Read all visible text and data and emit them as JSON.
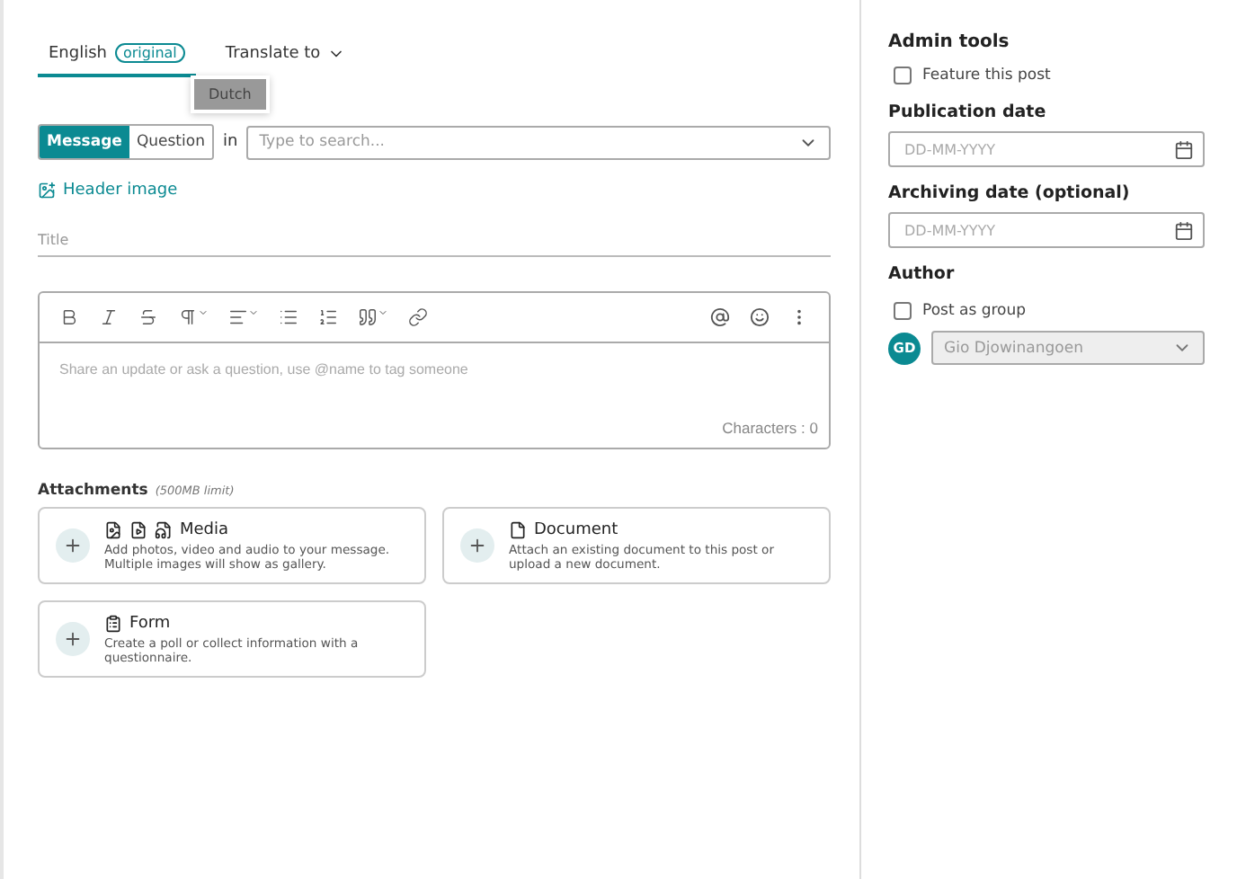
{
  "tabs": [
    {
      "label": "English",
      "badge": "original",
      "selected": true
    },
    {
      "label": "Translate to",
      "selected": false
    }
  ],
  "translate_menu": {
    "items": [
      {
        "label": "Dutch",
        "highlighted": true
      }
    ]
  },
  "post_type": [
    {
      "label": "Message",
      "selected": true
    },
    {
      "label": "Question",
      "selected": false
    }
  ],
  "in_label": "in",
  "channel_search": {
    "placeholder": "Type to search..."
  },
  "header_image_link": "Header image",
  "title_field": {
    "placeholder": "Title"
  },
  "editor": {
    "placeholder": "Share an update or ask a question, use @name to tag someone",
    "character_count": "Characters : 0"
  },
  "attachments": {
    "heading": "Attachments",
    "limit": "(500MB limit)",
    "options": [
      {
        "kind": "media",
        "title": "Media",
        "description": "Add photos, video and audio to your message. Multiple images will show as gallery."
      },
      {
        "kind": "document",
        "title": "Document",
        "description": "Attach an existing document to this post or upload a new document."
      },
      {
        "kind": "form",
        "title": "Form",
        "description": "Create a poll or collect information with a questionnaire."
      }
    ]
  },
  "admin_tools": {
    "title": "Admin tools",
    "feature_post": {
      "label": "Feature this post",
      "checked": false
    },
    "publication_date": {
      "label": "Publication date",
      "placeholder": "DD-MM-YYYY"
    },
    "archiving_date": {
      "label": "Archiving date (optional)",
      "placeholder": "DD-MM-YYYY"
    },
    "author_label": "Author",
    "post_as_group": {
      "label": "Post as group",
      "checked": false
    },
    "author": {
      "initials": "GD",
      "name": "Gio Djowinangoen",
      "disabled": true
    }
  }
}
